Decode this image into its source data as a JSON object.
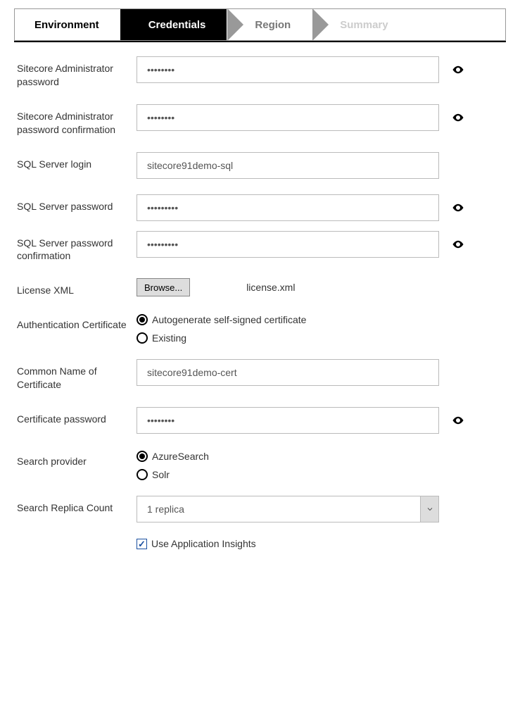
{
  "wizard": {
    "steps": [
      "Environment",
      "Credentials",
      "Region",
      "Summary"
    ],
    "active_index": 1
  },
  "fields": {
    "admin_pw_label": "Sitecore Administrator password",
    "admin_pw_value": "••••••••",
    "admin_pw_confirm_label": "Sitecore Administrator password confirmation",
    "admin_pw_confirm_value": "••••••••",
    "sql_login_label": "SQL Server login",
    "sql_login_value": "sitecore91demo-sql",
    "sql_pw_label": "SQL Server password",
    "sql_pw_value": "•••••••••",
    "sql_pw_confirm_label": "SQL Server password confirmation",
    "sql_pw_confirm_value": "•••••••••",
    "license_label": "License XML",
    "license_browse": "Browse...",
    "license_filename": "license.xml",
    "auth_cert_label": "Authentication Certificate",
    "auth_cert_options": {
      "auto": "Autogenerate self-signed certificate",
      "existing": "Existing"
    },
    "auth_cert_selected": "auto",
    "common_name_label": "Common Name of Certificate",
    "common_name_value": "sitecore91demo-cert",
    "cert_pw_label": "Certificate password",
    "cert_pw_value": "••••••••",
    "search_provider_label": "Search provider",
    "search_provider_options": {
      "azure": "AzureSearch",
      "solr": "Solr"
    },
    "search_provider_selected": "azure",
    "replica_label": "Search Replica Count",
    "replica_value": "1 replica",
    "app_insights_label": "Use Application Insights",
    "app_insights_checked": true
  }
}
